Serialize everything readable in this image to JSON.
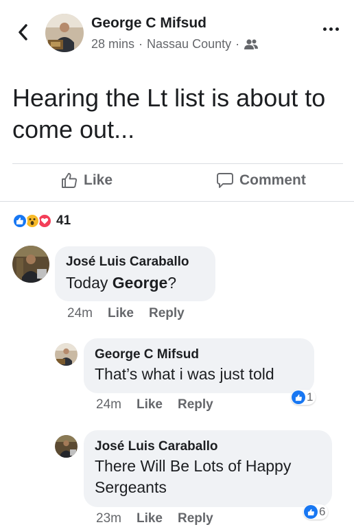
{
  "post": {
    "author": "George C Mifsud",
    "time": "28 mins",
    "separator": "·",
    "location": "Nassau County",
    "audience_icon": "friends-icon",
    "text": "Hearing the Lt list is about to come out..."
  },
  "actions": {
    "like_label": "Like",
    "comment_label": "Comment"
  },
  "reactions": {
    "icons": [
      "like-reaction-icon",
      "wow-reaction-icon",
      "love-reaction-icon"
    ],
    "count": "41"
  },
  "comments": [
    {
      "author": "José Luis Caraballo",
      "text_pre": "Today ",
      "text_bold": "George",
      "text_post": "?",
      "time": "24m",
      "like_label": "Like",
      "reply_label": "Reply"
    },
    {
      "author": "George C Mifsud",
      "text": "That’s what i was just told",
      "time": "24m",
      "like_label": "Like",
      "reply_label": "Reply",
      "like_count": "1"
    },
    {
      "author": "José Luis Caraballo",
      "text_line1": "There Will Be Lots of Happy",
      "text_line2": "Sergeants",
      "time": "23m",
      "like_label": "Like",
      "reply_label": "Reply",
      "like_count": "6"
    }
  ],
  "colors": {
    "accent": "#1877f2",
    "love": "#f33e58",
    "wow": "#f7b928",
    "muted": "#65676b",
    "bubble": "#f0f2f5"
  }
}
